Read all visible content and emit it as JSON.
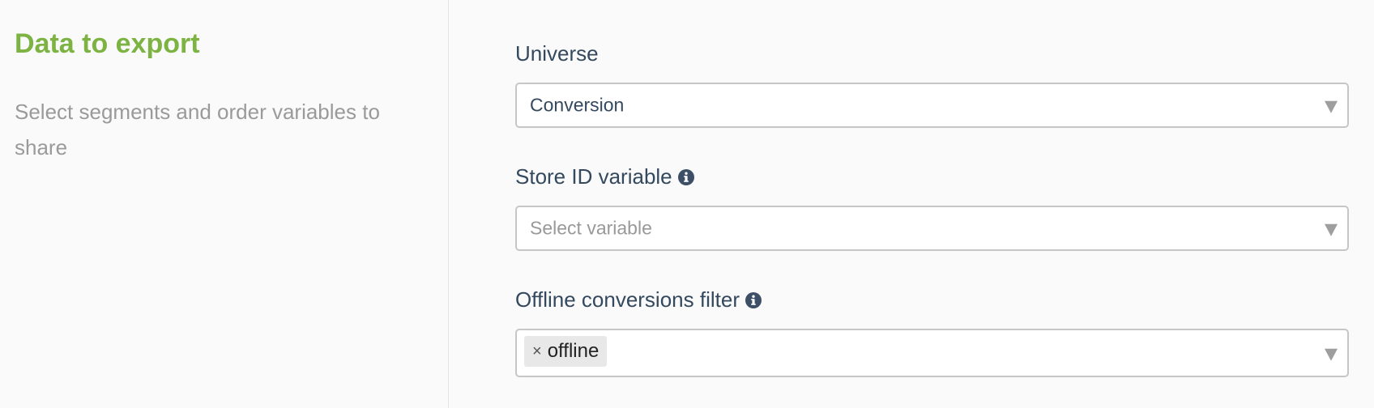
{
  "left": {
    "title": "Data to export",
    "description": "Select segments and order variables to share"
  },
  "fields": {
    "universe": {
      "label": "Universe",
      "value": "Conversion"
    },
    "store_id": {
      "label": "Store ID variable",
      "placeholder": "Select variable"
    },
    "offline_filter": {
      "label": "Offline conversions filter",
      "tags": [
        {
          "label": "offline",
          "remove": "×"
        }
      ]
    }
  },
  "icons": {
    "info": "info-circle-icon",
    "dropdown": "triangle-down-icon",
    "remove": "close-icon"
  },
  "colors": {
    "accent": "#7cb342",
    "label": "#34495e",
    "description": "#9a9a9a",
    "border": "#c6c6c6"
  }
}
